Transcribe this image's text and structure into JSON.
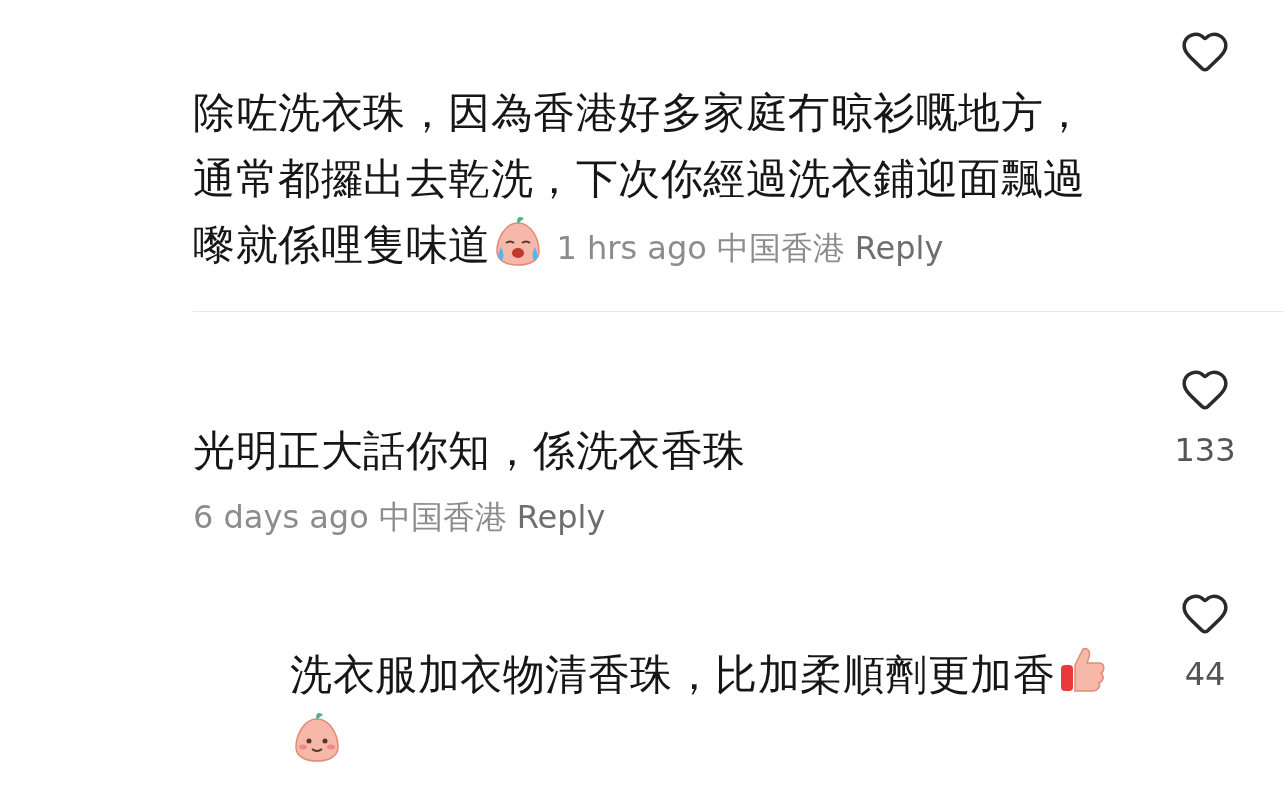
{
  "comments": [
    {
      "kind": "comment",
      "liked": false,
      "parts": [
        {
          "kind": "text-block",
          "text": "除咗洗衣珠，因為香港好多家庭冇晾衫嘅地方，通常都攞出去乾洗，下次你經過洗衣鋪迎面飄過"
        },
        {
          "kind": "text",
          "text": "嚟就係哩隻味道"
        },
        {
          "kind": "crying-sticker"
        },
        {
          "kind": "meta",
          "time": "1 hrs ago",
          "location": "中国香港",
          "reply": "Reply"
        }
      ]
    },
    {
      "kind": "comment",
      "liked": false,
      "count": "133",
      "parts": [
        {
          "kind": "text",
          "text": "光明正大話你知，係洗衣香珠"
        }
      ],
      "meta": {
        "time": "6 days ago",
        "location": "中国香港",
        "reply": "Reply"
      }
    },
    {
      "kind": "reply",
      "liked": false,
      "count": "44",
      "parts": [
        {
          "kind": "text",
          "text": "洗衣服加衣物清香珠，比加柔順劑更加香"
        },
        {
          "kind": "thumbs-sticker"
        },
        {
          "kind": "smile-sticker"
        }
      ]
    }
  ]
}
